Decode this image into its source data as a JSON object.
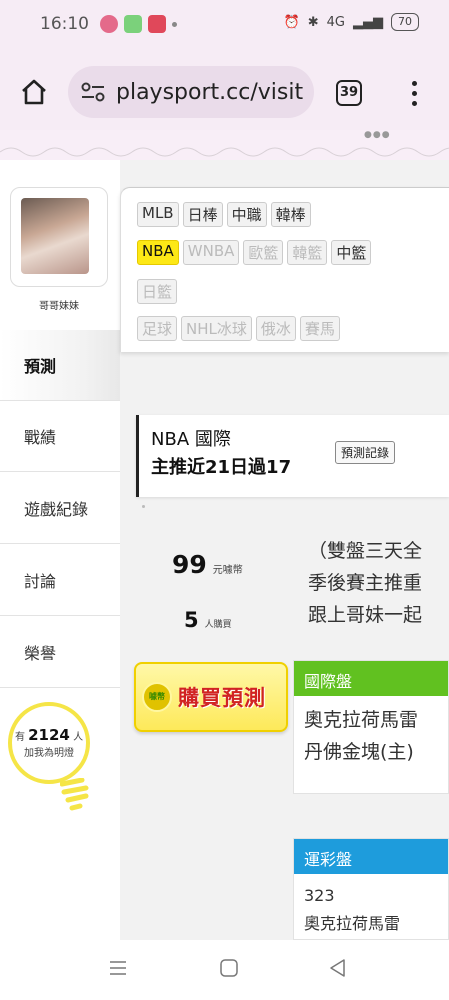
{
  "status": {
    "time": "16:10",
    "battery": "70",
    "network": "4G",
    "alarm_icon": "alarm-icon",
    "bluetooth_icon": "bluetooth-icon"
  },
  "browser": {
    "url": "playsport.cc/visit",
    "tab_count": "39"
  },
  "profile": {
    "name": "哥哥妹妹"
  },
  "filters": {
    "row1": [
      "MLB",
      "日棒",
      "中職",
      "韓棒"
    ],
    "row2": [
      "NBA",
      "WNBA",
      "歐籃",
      "韓籃",
      "中籃"
    ],
    "row3": [
      "日籃"
    ],
    "row4": [
      "足球",
      "NHL冰球",
      "俄冰",
      "賽馬"
    ]
  },
  "leftnav": {
    "items": [
      "預測",
      "戰績",
      "遊戲紀錄",
      "討論",
      "榮譽"
    ]
  },
  "fans": {
    "prefix": "有",
    "count": "2124",
    "suffix": "人",
    "caption": "加我為明燈"
  },
  "card": {
    "league": "NBA 國際",
    "record": "主推近21日過17",
    "history_button": "預測記錄"
  },
  "stats": {
    "price": "99",
    "price_unit": "元噱幣",
    "buyers": "5",
    "buyers_unit": "人購買"
  },
  "description": [
    "（雙盤三天全",
    "季後賽主推重",
    "跟上哥妹一起"
  ],
  "buy_button": {
    "label": "購買預測",
    "icon_text": "噱幣"
  },
  "panels": {
    "intl": {
      "title": "國際盤",
      "lines": [
        "奧克拉荷馬雷",
        "丹佛金塊(主)"
      ]
    },
    "lottery": {
      "title": "運彩盤",
      "lines": [
        "323",
        "奧克拉荷馬雷"
      ]
    }
  },
  "colors": {
    "accent_yellow": "#fde816",
    "green": "#61c120",
    "blue": "#1e9cdc",
    "red": "#d12323"
  }
}
